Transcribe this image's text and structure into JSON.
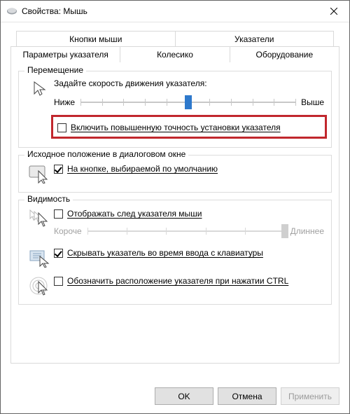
{
  "window": {
    "title": "Свойства: Мышь"
  },
  "tabs": [
    "Кнопки мыши",
    "Указатели",
    "Параметры указателя",
    "Колесико",
    "Оборудование"
  ],
  "motion": {
    "title": "Перемещение",
    "speed_label": "Задайте скорость движения указателя:",
    "slow": "Ниже",
    "fast": "Выше",
    "speed_value": 5,
    "speed_max": 10,
    "precision": "Включить повышенную точность установки указателя",
    "precision_checked": false
  },
  "snap": {
    "title": "Исходное положение в диалоговом окне",
    "label": "На кнопке, выбираемой по умолчанию",
    "checked": true
  },
  "visibility": {
    "title": "Видимость",
    "trails": "Отображать след указателя мыши",
    "trails_checked": false,
    "short": "Короче",
    "long": "Длиннее",
    "trail_slider_enabled": false,
    "hide_typing": "Скрывать указатель во время ввода с клавиатуры",
    "hide_typing_checked": true,
    "ctrl_locate": "Обозначить расположение указателя при нажатии CTRL",
    "ctrl_locate_checked": false
  },
  "buttons": {
    "ok": "OK",
    "cancel": "Отмена",
    "apply": "Применить"
  }
}
